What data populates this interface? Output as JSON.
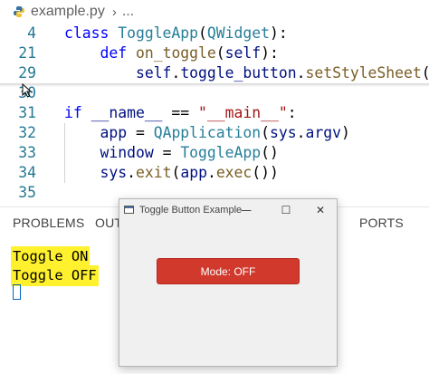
{
  "editor": {
    "breadcrumb": {
      "file": "example.py",
      "more": "..."
    },
    "lines": [
      {
        "number": "4",
        "tokens": [
          [
            "kw",
            "class "
          ],
          [
            "cls",
            "ToggleApp"
          ],
          [
            "plain",
            "("
          ],
          [
            "cls",
            "QWidget"
          ],
          [
            "plain",
            "):"
          ]
        ]
      },
      {
        "number": "21",
        "tokens": [
          [
            "plain",
            "    "
          ],
          [
            "kw",
            "def "
          ],
          [
            "fn",
            "on_toggle"
          ],
          [
            "plain",
            "("
          ],
          [
            "var",
            "self"
          ],
          [
            "plain",
            "):"
          ]
        ]
      },
      {
        "number": "29",
        "tokens": [
          [
            "plain",
            "        "
          ],
          [
            "var",
            "self"
          ],
          [
            "plain",
            "."
          ],
          [
            "var",
            "toggle_button"
          ],
          [
            "plain",
            "."
          ],
          [
            "fn",
            "setStyleSheet"
          ],
          [
            "plain",
            "("
          ]
        ]
      },
      {
        "number": "30",
        "tokens": []
      },
      {
        "number": "31",
        "tokens": [
          [
            "kw",
            "if "
          ],
          [
            "var",
            "__name__"
          ],
          [
            "plain",
            " == "
          ],
          [
            "str",
            "\"__main__\""
          ],
          [
            "plain",
            ":"
          ]
        ]
      },
      {
        "number": "32",
        "tokens": [
          [
            "plain",
            "    "
          ],
          [
            "var",
            "app"
          ],
          [
            "plain",
            " = "
          ],
          [
            "cls",
            "QApplication"
          ],
          [
            "plain",
            "("
          ],
          [
            "var",
            "sys"
          ],
          [
            "plain",
            "."
          ],
          [
            "var",
            "argv"
          ],
          [
            "plain",
            ")"
          ]
        ]
      },
      {
        "number": "33",
        "tokens": [
          [
            "plain",
            "    "
          ],
          [
            "var",
            "window"
          ],
          [
            "plain",
            " = "
          ],
          [
            "cls",
            "ToggleApp"
          ],
          [
            "plain",
            "()"
          ]
        ]
      },
      {
        "number": "34",
        "tokens": [
          [
            "plain",
            "    "
          ],
          [
            "var",
            "sys"
          ],
          [
            "plain",
            "."
          ],
          [
            "fn",
            "exit"
          ],
          [
            "plain",
            "("
          ],
          [
            "var",
            "app"
          ],
          [
            "plain",
            "."
          ],
          [
            "fn",
            "exec"
          ],
          [
            "plain",
            "())"
          ]
        ]
      },
      {
        "number": "35",
        "tokens": []
      }
    ]
  },
  "panel": {
    "tabs": [
      "PROBLEMS",
      "OUT",
      "PORTS"
    ],
    "terminal_lines": [
      "Toggle ON",
      "Toggle OFF"
    ]
  },
  "window": {
    "title": "Toggle Button Example",
    "minimize_symbol": "—",
    "maximize_symbol": "☐",
    "close_symbol": "✕",
    "button_label": "Mode: OFF",
    "button_color": "#d0392b"
  },
  "colors": {
    "keyword": "#0000ff",
    "function": "#795e26",
    "class": "#267f99",
    "variable": "#001080",
    "string": "#a31515",
    "line_number": "#237893",
    "highlight": "#fff12d"
  }
}
